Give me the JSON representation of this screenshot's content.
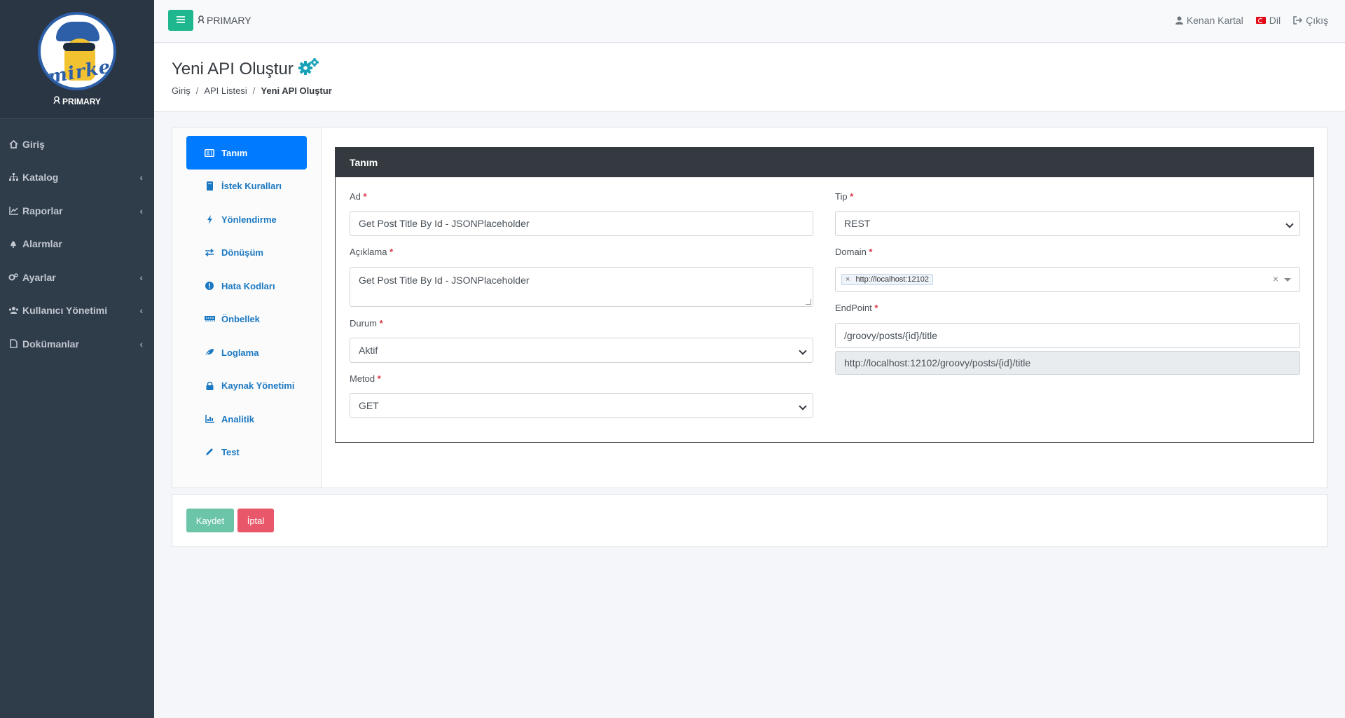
{
  "app": {
    "brand_label": "PRIMARY",
    "logo_text": "mirket"
  },
  "sidebar": {
    "items": [
      {
        "label": "Giriş",
        "icon": "home-icon",
        "has_arrow": false
      },
      {
        "label": "Katalog",
        "icon": "sitemap-icon",
        "has_arrow": true
      },
      {
        "label": "Raporlar",
        "icon": "chart-icon",
        "has_arrow": true
      },
      {
        "label": "Alarmlar",
        "icon": "bell-icon",
        "has_arrow": false
      },
      {
        "label": "Ayarlar",
        "icon": "cogs-icon",
        "has_arrow": true
      },
      {
        "label": "Kullanıcı Yönetimi",
        "icon": "users-icon",
        "has_arrow": true
      },
      {
        "label": "Dokümanlar",
        "icon": "file-icon",
        "has_arrow": true
      }
    ]
  },
  "topbar": {
    "workspace": "PRIMARY",
    "user": "Kenan Kartal",
    "language": "Dil",
    "logout": "Çıkış"
  },
  "header": {
    "title": "Yeni API Oluştur",
    "breadcrumb": [
      "Giriş",
      "API Listesi",
      "Yeni API Oluştur"
    ]
  },
  "tabs": [
    {
      "label": "Tanım",
      "icon": "id-card-icon",
      "active": true
    },
    {
      "label": "İstek Kuralları",
      "icon": "book-icon",
      "active": false
    },
    {
      "label": "Yönlendirme",
      "icon": "bolt-icon",
      "active": false
    },
    {
      "label": "Dönüşüm",
      "icon": "exchange-icon",
      "active": false
    },
    {
      "label": "Hata Kodları",
      "icon": "exclamation-icon",
      "active": false
    },
    {
      "label": "Önbellek",
      "icon": "memory-icon",
      "active": false
    },
    {
      "label": "Loglama",
      "icon": "leaf-icon",
      "active": false
    },
    {
      "label": "Kaynak Yönetimi",
      "icon": "lock-icon",
      "active": false
    },
    {
      "label": "Analitik",
      "icon": "chart-icon",
      "active": false
    },
    {
      "label": "Test",
      "icon": "pen-icon",
      "active": false
    }
  ],
  "form": {
    "section_title": "Tanım",
    "required_mark": "*",
    "name": {
      "label": "Ad",
      "value": "Get Post Title By Id - JSONPlaceholder"
    },
    "description": {
      "label": "Açıklama",
      "value": "Get Post Title By Id - JSONPlaceholder"
    },
    "status": {
      "label": "Durum",
      "value": "Aktif"
    },
    "method": {
      "label": "Metod",
      "value": "GET"
    },
    "type": {
      "label": "Tip",
      "value": "REST"
    },
    "domain": {
      "label": "Domain",
      "tag": "http://localhost:12102",
      "tag_remove": "×",
      "clear": "×"
    },
    "endpoint": {
      "label": "EndPoint",
      "value": "/groovy/posts/{id}/title",
      "full_url": "http://localhost:12102/groovy/posts/{id}/title"
    }
  },
  "actions": {
    "save": "Kaydet",
    "cancel": "İptal"
  },
  "colors": {
    "sidebar": "#2f3d4b",
    "primary": "#007bff",
    "accent": "#1fb78e",
    "danger": "#e8586a",
    "link": "#1a78c2"
  }
}
